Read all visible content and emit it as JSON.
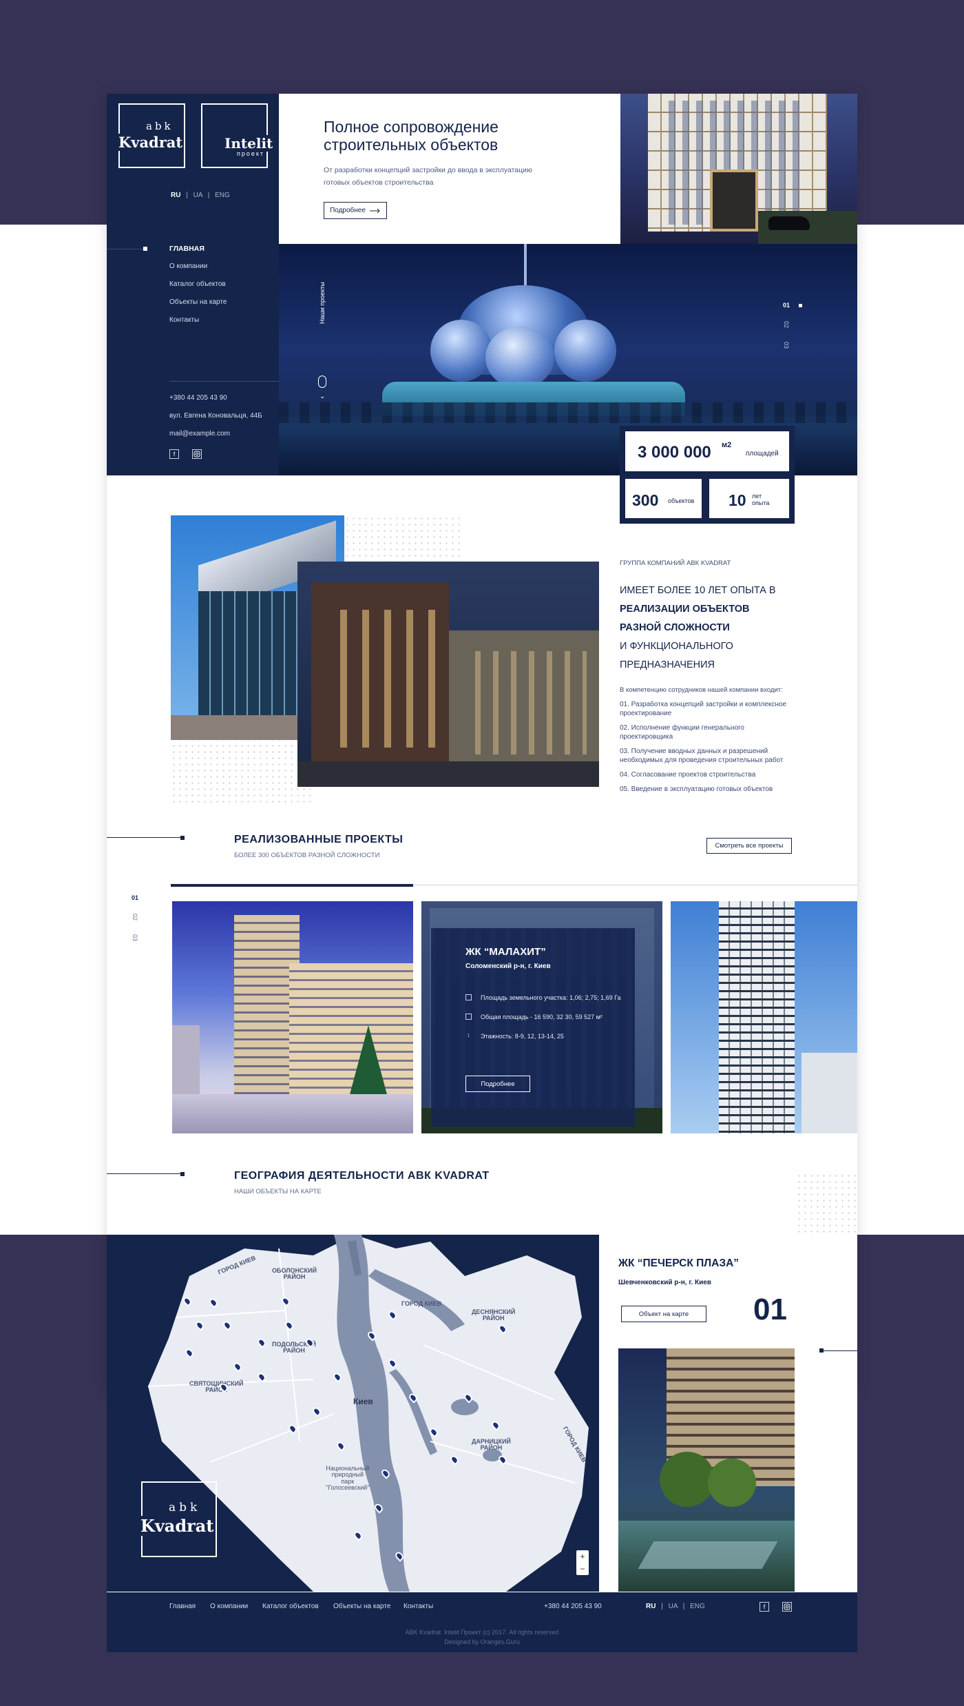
{
  "brand": {
    "abk_small": "abk",
    "abk_name": "Kvadrat",
    "intelit_name": "Intelit",
    "intelit_small": "проект"
  },
  "languages": {
    "ru": "RU",
    "ua": "UA",
    "eng": "ENG",
    "sep": "|"
  },
  "nav": [
    {
      "label": "ГЛАВНАЯ"
    },
    {
      "label": "О компании"
    },
    {
      "label": "Каталог объектов"
    },
    {
      "label": "Объекты на карте"
    },
    {
      "label": "Контакты"
    }
  ],
  "contacts": {
    "phone": "+380 44 205 43 90",
    "address": "вул. Евгена Коновальця, 44Б",
    "email": "mail@example.com"
  },
  "hero": {
    "title_line1": "Полное сопровождение",
    "title_line2": "строительных объектов",
    "subtitle_line1": "От разработки концепций застройки до ввода в эксплуатацию",
    "subtitle_line2": "готовых объектов строительства",
    "more_button": "Подробнее",
    "vertical_label": "Наши проекты",
    "slides": [
      "01",
      "02",
      "03"
    ]
  },
  "stats": {
    "area_value": "3 000 000",
    "area_unit": "м2",
    "area_label": "площадей",
    "objects_value": "300",
    "objects_label": "объектов",
    "years_value": "10",
    "years_label1": "лет",
    "years_label2": "опыта"
  },
  "about": {
    "overline": "ГРУППА КОМПАНИЙ АВК KVADRAT",
    "heading1": "ИМЕЕТ БОЛЕЕ 10 ЛЕТ ОПЫТА В",
    "heading2": "РЕАЛИЗАЦИИ ОБЪЕКТОВ",
    "heading3": "РАЗНОЙ СЛОЖНОСТИ",
    "heading4": "И ФУНКЦИОНАЛЬНОГО",
    "heading5": "ПРЕДНАЗНАЧЕНИЯ",
    "intro": "В компетенцию сотрудников нашей компании входит:",
    "items": [
      "01. Разработка концепций застройки и комплексное проектирование",
      "02.  Исполнение функции генерального проектировщика",
      "03.  Получение вводных данных и разрешений необходимых для проведения строительных работ",
      "04. Согласование проектов строительства",
      "05. Введение в эксплуатацию готовых объектов"
    ]
  },
  "projects": {
    "title": "РЕАЛИЗОВАННЫЕ ПРОЕКТЫ",
    "subtitle": "БОЛЕЕ 300 ОБЪЕКТОВ РАЗНОЙ СЛОЖНОСТИ",
    "view_all": "Смотреть все проекты",
    "pages": [
      "01",
      "02",
      "03"
    ],
    "featured": {
      "name": "ЖК “МАЛАХИТ”",
      "location": "Соломенский р-н, г. Киев",
      "spec1": "Площадь земельного участка: 1,06; 2,75; 1,69 Га",
      "spec2": "Общая площадь - 16 590, 32 30, 59 527 м²",
      "spec3": "Этажность: 8-9, 12, 13-14, 25",
      "button": "Подробнее"
    }
  },
  "geography": {
    "title": "ГЕОГРАФИЯ ДЕЯТЕЛЬНОСТИ АВК KVADRAT",
    "subtitle": "НАШИ ОБЪЕКТЫ НА КАРТЕ",
    "map_labels": {
      "kyiv_top": "ГОРОД КИЕВ",
      "obolonsky": "ОБОЛОНСКИЙ\nРАЙОН",
      "podolsky": "ПОДОЛЬСКИЙ\nРАЙОН",
      "svyatoshinsky": "СВЯТОШИНСКИЙ\nРАЙОН",
      "kyiv": "Киев",
      "kyiv_right": "ГОРОД КИЕВ",
      "desnyansky": "ДЕСНЯНСКИЙ\nРАЙОН",
      "darnitsky": "ДАРНИЦКИЙ\nРАЙОН",
      "park": "Национальный\nприродный\nпарк\n\"Голосеевский\"",
      "kyiv_se": "ГОРОД КИЕВ"
    },
    "zoom_in": "+",
    "zoom_out": "−",
    "object": {
      "name": "ЖК “ПЕЧЕРСК ПЛАЗА”",
      "location": "Шевченковский р-н, г. Киев",
      "button": "Объект на карте",
      "number": "01"
    }
  },
  "footer": {
    "links": [
      "Главная",
      "О компании",
      "Каталог объектов",
      "Объекты на карте",
      "Контакты"
    ],
    "phone": "+380 44 205 43 90",
    "copyright": "ABK Kvadrat. Intelit Проект (c) 2017. All rights reserved",
    "designed": "Designed by Oranges.Guru"
  },
  "colors": {
    "navy": "#14244a",
    "purple_bg": "#363256",
    "map_land": "#e9ecf2",
    "water": "#8391ad"
  }
}
